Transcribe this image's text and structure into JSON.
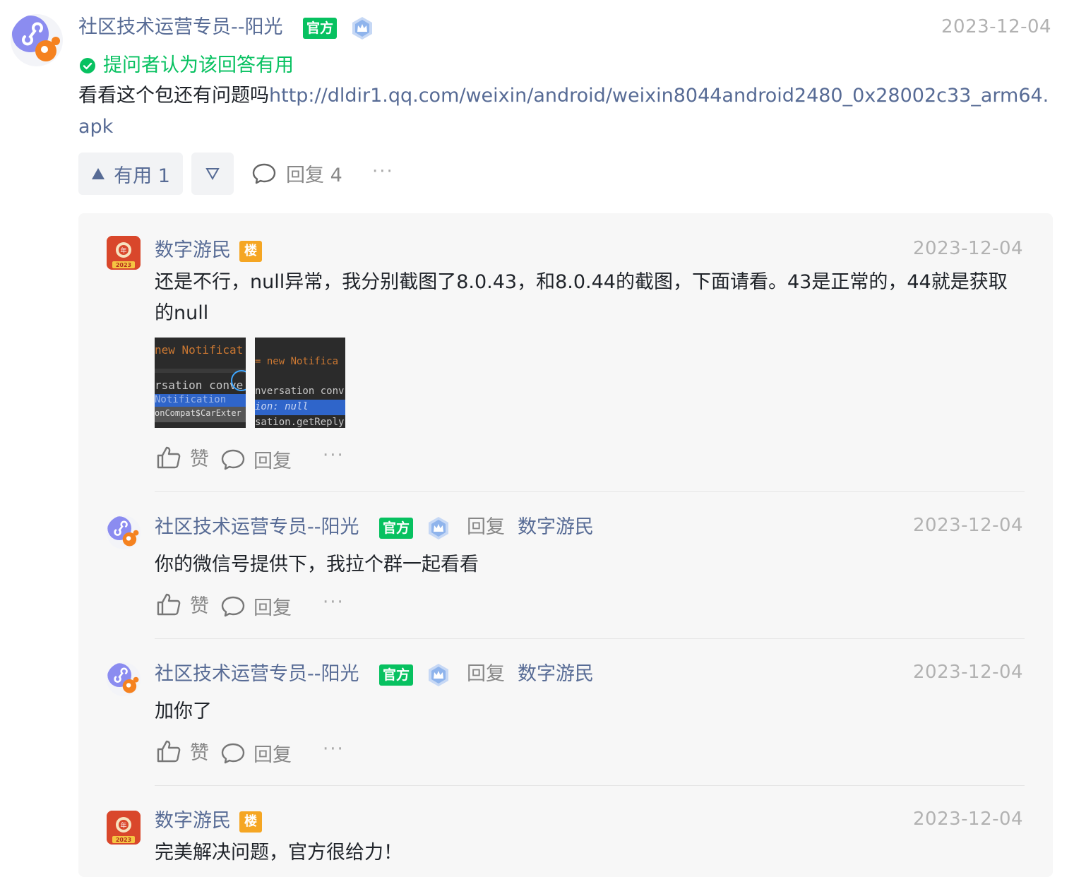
{
  "answer": {
    "author": "社区技术运营专员--阳光",
    "official_badge": "官方",
    "date": "2023-12-04",
    "accepted_text": "提问者认为该回答有用",
    "body_prefix": "看看这个包还有问题吗",
    "body_link": "http://dldir1.qq.com/weixin/android/weixin8044android2480_0x28002c33_arm64.apk",
    "useful_label": "有用 1",
    "reply_label": "回复 4",
    "more": "···"
  },
  "replies": [
    {
      "author": "数字游民",
      "floor_badge": "楼",
      "date": "2023-12-04",
      "text": "还是不行，null异常，我分别截图了8.0.43，和8.0.44的截图，下面请看。43是正常的，44就是获取的null",
      "like_label": "赞",
      "reply_label": "回复",
      "more": "···",
      "screenshot1_lines": [
        "new Notificat",
        "rsation conve",
        "Notification",
        "onCompat$CarExter"
      ],
      "screenshot2_lines": [
        "= new Notifica",
        "nversation conv",
        "ion: null",
        "sation.getReply"
      ]
    },
    {
      "author": "社区技术运营专员--阳光",
      "official_badge": "官方",
      "reply_word": "回复",
      "target": "数字游民",
      "date": "2023-12-04",
      "text": "你的微信号提供下，我拉个群一起看看",
      "like_label": "赞",
      "reply_label": "回复",
      "more": "···"
    },
    {
      "author": "社区技术运营专员--阳光",
      "official_badge": "官方",
      "reply_word": "回复",
      "target": "数字游民",
      "date": "2023-12-04",
      "text": "加你了",
      "like_label": "赞",
      "reply_label": "回复",
      "more": "···"
    },
    {
      "author": "数字游民",
      "floor_badge": "楼",
      "date": "2023-12-04",
      "text": "完美解决问题，官方很给力！"
    }
  ],
  "avatar_year_text": "年",
  "avatar_year_num": "2023",
  "colors": {
    "name": "#576b95",
    "official": "#07c160",
    "floor": "#f5a623",
    "date": "#b2b2b2"
  }
}
